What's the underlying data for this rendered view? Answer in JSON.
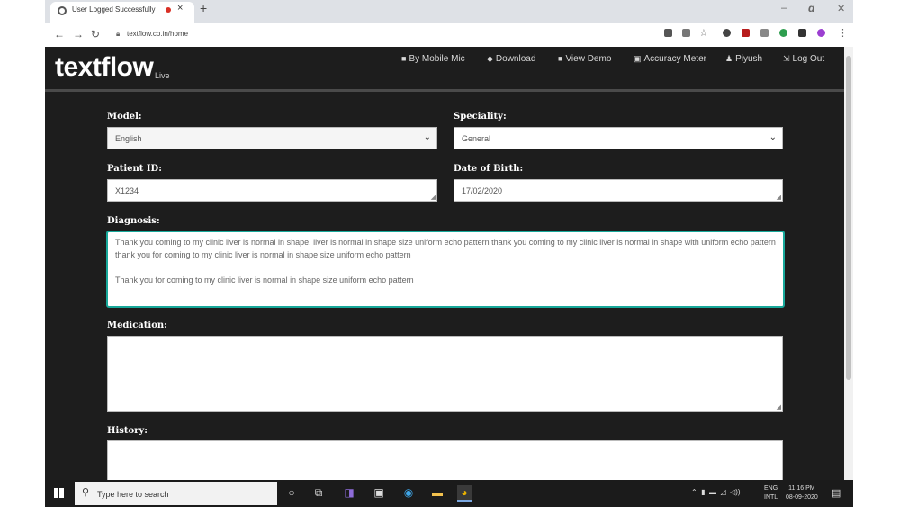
{
  "browser": {
    "tab_title": "User Logged Successfully",
    "new_tab": "+",
    "url": "textflow.co.in/home",
    "window_controls": {
      "minimize": "–",
      "maximize": "🗗",
      "close": "✕"
    }
  },
  "app": {
    "logo": "textflow",
    "logo_suffix": "Live",
    "nav": [
      {
        "icon": "microphone-icon",
        "label": "By Mobile Mic"
      },
      {
        "icon": "download-icon",
        "label": "Download"
      },
      {
        "icon": "video-icon",
        "label": "View Demo"
      },
      {
        "icon": "meter-icon",
        "label": "Accuracy Meter"
      },
      {
        "icon": "user-icon",
        "label": "Piyush"
      },
      {
        "icon": "logout-icon",
        "label": "Log Out"
      }
    ]
  },
  "form": {
    "model": {
      "label": "Model:",
      "value": "English"
    },
    "speciality": {
      "label": "Speciality:",
      "value": "General"
    },
    "patient_id": {
      "label": "Patient ID:",
      "value": "X1234"
    },
    "dob": {
      "label": "Date of Birth:",
      "value": "17/02/2020"
    },
    "diagnosis": {
      "label": "Diagnosis:",
      "value": "Thank you coming to my clinic liver is normal in shape. liver is normal in shape size uniform echo pattern thank you coming to my clinic liver is normal in shape with uniform echo pattern thank you for coming to my clinic liver is normal in shape size uniform echo pattern\n\nThank you for coming to my clinic liver is normal in shape size uniform echo pattern"
    },
    "medication": {
      "label": "Medication:",
      "value": ""
    },
    "history": {
      "label": "History:",
      "value": ""
    }
  },
  "taskbar": {
    "search_placeholder": "Type here to search",
    "tray_lang": "ENG",
    "tray_layout": "INTL",
    "time": "11:16 PM",
    "date": "08-09-2020"
  },
  "colors": {
    "accent": "#17a89a",
    "page_bg": "#1d1d1d"
  }
}
